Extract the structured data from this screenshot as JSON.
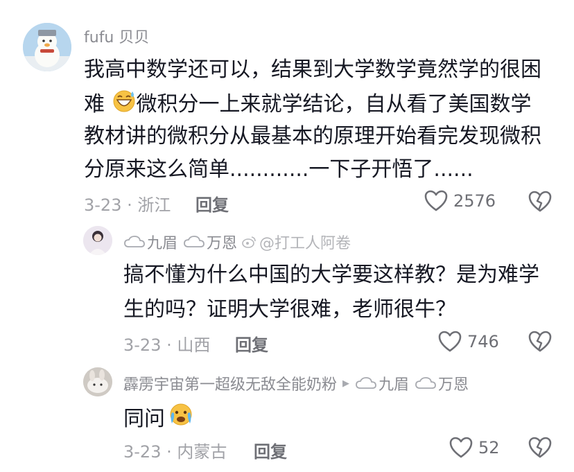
{
  "comments": [
    {
      "username": "fufu 贝贝",
      "text_lines": [
        "我高中数学还可以，结果到大学数学竟然学的很困",
        "微积分一上来就学结论，自从看了美国数学",
        "教材讲的微积分从最基本的原理开始看完发现微积",
        "分原来这么简单............一下子开悟了......"
      ],
      "text_line2_prefix": "难",
      "meta": "3-23 · 浙江",
      "reply_label": "回复",
      "likes": "2576"
    },
    {
      "user1": "九眉",
      "user2": "万恩",
      "watermark": "@打工人阿卷",
      "text_lines": [
        "搞不懂为什么中国的大学要这样教？是为难学",
        "生的吗？证明大学很难，老师很牛？"
      ],
      "meta": "3-23 · 山西",
      "reply_label": "回复",
      "likes": "746"
    },
    {
      "username": "霹雳宇宙第一超级无敌全能奶粉",
      "arrow": "▶",
      "reply_to1": "九眉",
      "reply_to2": "万恩",
      "text": "同问",
      "meta": "3-23 · 内蒙古",
      "reply_label": "回复",
      "likes": "52"
    }
  ],
  "colors": {
    "text": "#161823",
    "muted": "#8a8b91",
    "meta": "#a1a2a7"
  }
}
